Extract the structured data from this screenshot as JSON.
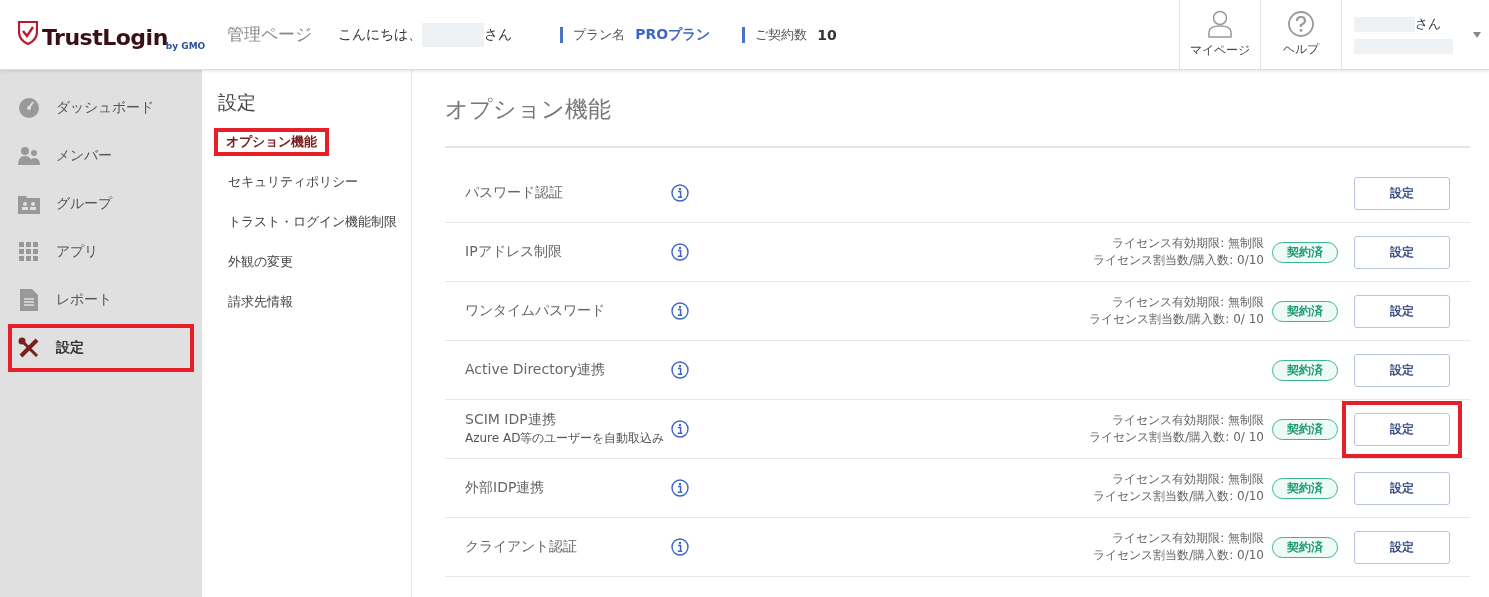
{
  "header": {
    "logo": "TrustLogin",
    "logo_sub": "by GMO",
    "page_name": "管理ページ",
    "greeting": "こんにちは、",
    "greeting_suffix": "さん",
    "plan_label": "プラン名",
    "plan_value": "PROプラン",
    "contracts_label": "ご契約数",
    "contracts_value": "10",
    "actions": [
      {
        "label": "マイページ",
        "kind": "person"
      },
      {
        "label": "ヘルプ",
        "kind": "help"
      }
    ],
    "user_suffix": "さん"
  },
  "sidebar": {
    "items": [
      {
        "label": "ダッシュボード",
        "kind": "gauge",
        "selected": false,
        "highlighted": false
      },
      {
        "label": "メンバー",
        "kind": "people",
        "selected": false,
        "highlighted": false
      },
      {
        "label": "グループ",
        "kind": "folder",
        "selected": false,
        "highlighted": false
      },
      {
        "label": "アプリ",
        "kind": "grid",
        "selected": false,
        "highlighted": false
      },
      {
        "label": "レポート",
        "kind": "document",
        "selected": false,
        "highlighted": false
      },
      {
        "label": "設定",
        "kind": "tools",
        "selected": true,
        "highlighted": true
      }
    ]
  },
  "submenu": {
    "title": "設定",
    "items": [
      {
        "label": "オプション機能",
        "selected": true,
        "highlighted": true
      },
      {
        "label": "セキュリティポリシー",
        "selected": false,
        "highlighted": false
      },
      {
        "label": "トラスト・ログイン機能制限",
        "selected": false,
        "highlighted": false
      },
      {
        "label": "外観の変更",
        "selected": false,
        "highlighted": false
      },
      {
        "label": "請求先情報",
        "selected": false,
        "highlighted": false
      }
    ]
  },
  "main": {
    "title": "オプション機能",
    "options": [
      {
        "name": "パスワード認証",
        "button": "設定",
        "highlighted": false
      },
      {
        "name": "IPアドレス制限",
        "license_period": "ライセンス有効期限: 無制限",
        "license_count": "ライセンス割当数/購入数: 0/10",
        "badge": "契約済",
        "button": "設定",
        "highlighted": false
      },
      {
        "name": "ワンタイムパスワード",
        "license_period": "ライセンス有効期限: 無制限",
        "license_count": "ライセンス割当数/購入数: 0/ 10",
        "badge": "契約済",
        "button": "設定",
        "highlighted": false
      },
      {
        "name": "Active Directory連携",
        "badge": "契約済",
        "button": "設定",
        "highlighted": false
      },
      {
        "name": "SCIM IDP連携",
        "description": "Azure AD等のユーザーを自動取込み",
        "license_period": "ライセンス有効期限: 無制限",
        "license_count": "ライセンス割当数/購入数: 0/ 10",
        "badge": "契約済",
        "button": "設定",
        "highlighted": true
      },
      {
        "name": "外部IDP連携",
        "license_period": "ライセンス有効期限: 無制限",
        "license_count": "ライセンス割当数/購入数: 0/10",
        "badge": "契約済",
        "button": "設定",
        "highlighted": false
      },
      {
        "name": "クライアント認証",
        "license_period": "ライセンス有効期限: 無制限",
        "license_count": "ライセンス割当数/購入数: 0/10",
        "badge": "契約済",
        "button": "設定",
        "highlighted": false
      }
    ]
  }
}
